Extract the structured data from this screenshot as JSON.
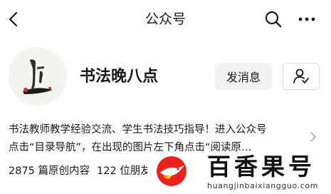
{
  "header": {
    "title": "公众号",
    "back_icon": "chevron-left-icon",
    "search_icon": "search-icon",
    "more_icon": "more-dots-icon"
  },
  "profile": {
    "name": "书法晚八点",
    "avatar_icon": "calligraphy-avatar",
    "message_button": "发消息",
    "follow_icon": "user-follow-icon"
  },
  "description": {
    "line1": "书法教师教学经验交流、学生书法技巧指导！进入公众号",
    "line2": "点击“目录导航”，在出现的图片左下角点击“阅读原…",
    "chevron_icon": "chevron-right-icon"
  },
  "stats": {
    "original_count": "2875 篇原创内容",
    "friends_text": "122 位朋友"
  },
  "watermark": {
    "brand_text": "百香果号",
    "url": "huangjinbaixiangguo.com",
    "logo_icon": "bird-logo",
    "brand_color": "#e8221d"
  }
}
